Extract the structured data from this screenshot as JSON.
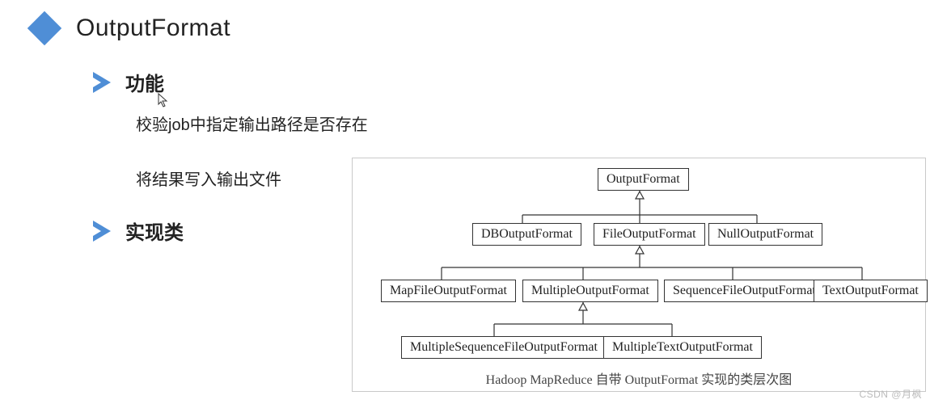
{
  "title": "OutputFormat",
  "sections": {
    "func": {
      "label": "功能",
      "items": [
        "校验job中指定输出路径是否存在",
        "将结果写入输出文件"
      ]
    },
    "impl": {
      "label": "实现类"
    }
  },
  "chart_data": {
    "type": "tree",
    "title": "Hadoop MapReduce 自带 OutputFormat 实现的类层次图",
    "nodes": {
      "root": "OutputFormat",
      "l1a": "DBOutputFormat",
      "l1b": "FileOutputFormat",
      "l1c": "NullOutputFormat",
      "l2a": "MapFileOutputFormat",
      "l2b": "MultipleOutputFormat",
      "l2c": "SequenceFileOutputFormat",
      "l2d": "TextOutputFormat",
      "l3a": "MultipleSequenceFileOutputFormat",
      "l3b": "MultipleTextOutputFormat"
    },
    "edges": [
      [
        "l1a",
        "root"
      ],
      [
        "l1b",
        "root"
      ],
      [
        "l1c",
        "root"
      ],
      [
        "l2a",
        "l1b"
      ],
      [
        "l2b",
        "l1b"
      ],
      [
        "l2c",
        "l1b"
      ],
      [
        "l2d",
        "l1b"
      ],
      [
        "l3a",
        "l2b"
      ],
      [
        "l3b",
        "l2b"
      ]
    ]
  },
  "watermark": "CSDN @月枫"
}
